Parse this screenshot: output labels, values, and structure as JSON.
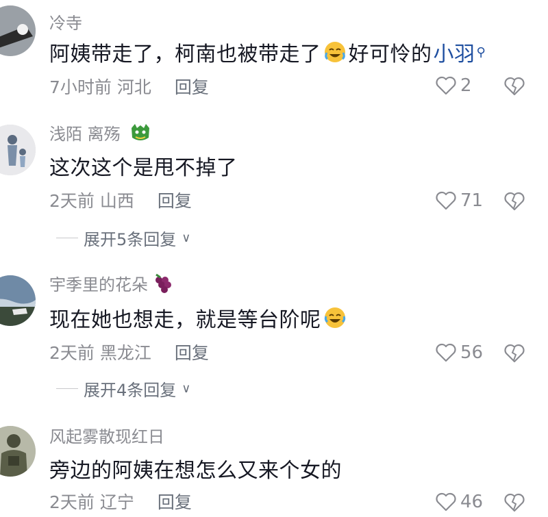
{
  "comments": [
    {
      "author": "冷寺",
      "author_badge": "",
      "text_parts": [
        "阿姨带走了，柯南也被带走了",
        "好可怜的"
      ],
      "emoji": "crying-laughing-emoji",
      "mention": "小羽",
      "time": "7小时前",
      "location": "河北",
      "reply_label": "回复",
      "likes": "2"
    },
    {
      "author": "浅陌  离殇",
      "author_badge": "dragon-emoji",
      "text_parts": [
        "这次这个是甩不掉了"
      ],
      "time": "2天前",
      "location": "山西",
      "reply_label": "回复",
      "likes": "71",
      "expand_label": "展开5条回复"
    },
    {
      "author": "宇季里的花朵",
      "author_badge": "grapes-emoji",
      "text_parts": [
        "现在她也想走，就是等台阶呢"
      ],
      "emoji": "laughing-emoji",
      "time": "2天前",
      "location": "黑龙江",
      "reply_label": "回复",
      "likes": "56",
      "expand_label": "展开4条回复"
    },
    {
      "author": "风起雾散现红日",
      "author_badge": "",
      "text_parts": [
        "旁边的阿姨在想怎么又来个女的"
      ],
      "time": "2天前",
      "location": "辽宁",
      "reply_label": "回复",
      "likes": "46"
    }
  ],
  "colors": {
    "meta": "#8a8b91",
    "text": "#161823",
    "mention": "#1f4fa0"
  }
}
